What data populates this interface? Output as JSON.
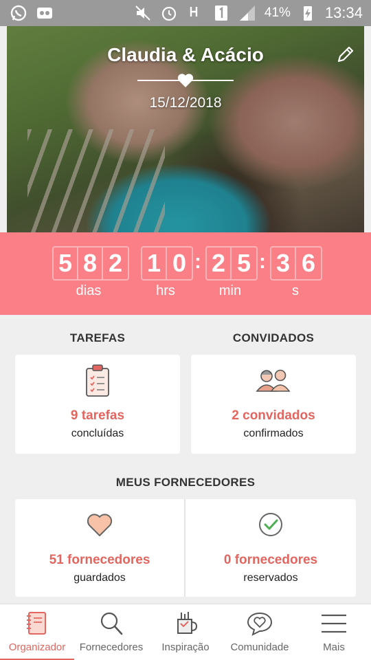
{
  "status": {
    "battery": "41%",
    "time": "13:34"
  },
  "couple": {
    "names": "Claudia & Acácio",
    "date": "15/12/2018"
  },
  "countdown": {
    "days": [
      "5",
      "8",
      "2"
    ],
    "hours": [
      "1",
      "0"
    ],
    "minutes": [
      "2",
      "5"
    ],
    "seconds": [
      "3",
      "6"
    ],
    "labels": {
      "days": "dias",
      "hours": "hrs",
      "minutes": "min",
      "seconds": "s"
    }
  },
  "tasks": {
    "title": "TAREFAS",
    "count": "9 tarefas",
    "sub": "concluídas"
  },
  "guests": {
    "title": "CONVIDADOS",
    "count": "2 convidados",
    "sub": "confirmados"
  },
  "vendors": {
    "title": "MEUS FORNECEDORES",
    "saved": {
      "count": "51 fornecedores",
      "sub": "guardados"
    },
    "booked": {
      "count": "0 fornecedores",
      "sub": "reservados"
    }
  },
  "nav": [
    {
      "label": "Organizador",
      "icon": "planner-icon",
      "active": true
    },
    {
      "label": "Fornecedores",
      "icon": "search-icon"
    },
    {
      "label": "Inspiração",
      "icon": "inspiration-icon"
    },
    {
      "label": "Comunidade",
      "icon": "community-icon"
    },
    {
      "label": "Mais",
      "icon": "menu-icon"
    }
  ],
  "colors": {
    "accent": "#e2665f",
    "countdown_bg": "#fb7f86",
    "statusbar": "#9a9a9a"
  }
}
